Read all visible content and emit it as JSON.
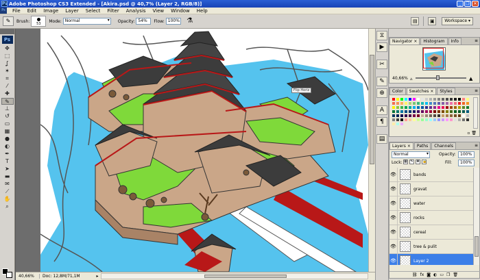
{
  "window": {
    "title": "Adobe Photoshop CS3 Extended - [Akira.psd @ 40,7% (Layer 2, RGB/8)]",
    "logo": "Ps",
    "buttons": {
      "minimize": "_",
      "restore": "❐",
      "close": "✕"
    }
  },
  "menu": [
    "File",
    "Edit",
    "Image",
    "Layer",
    "Select",
    "Filter",
    "Analysis",
    "View",
    "Window",
    "Help"
  ],
  "options": {
    "brush_label": "Brush:",
    "brush_size": "53",
    "mode_label": "Mode:",
    "mode_value": "Normal",
    "opacity_label": "Opacity:",
    "opacity_value": "54%",
    "flow_label": "Flow:",
    "flow_value": "100%",
    "workspace_label": "Workspace"
  },
  "toolbox": {
    "logo": "Ps",
    "tools": [
      {
        "name": "move-tool-icon",
        "glyph": "✥"
      },
      {
        "name": "marquee-tool-icon",
        "glyph": "⬚"
      },
      {
        "name": "lasso-tool-icon",
        "glyph": "ʆ"
      },
      {
        "name": "magic-wand-tool-icon",
        "glyph": "✶"
      },
      {
        "name": "crop-tool-icon",
        "glyph": "⌗"
      },
      {
        "name": "slice-tool-icon",
        "glyph": "⁄"
      },
      {
        "name": "healing-brush-tool-icon",
        "glyph": "✚"
      },
      {
        "name": "brush-tool-icon",
        "glyph": "✎",
        "selected": true
      },
      {
        "name": "clone-stamp-tool-icon",
        "glyph": "⊥"
      },
      {
        "name": "history-brush-tool-icon",
        "glyph": "↺"
      },
      {
        "name": "eraser-tool-icon",
        "glyph": "▭"
      },
      {
        "name": "gradient-tool-icon",
        "glyph": "▦"
      },
      {
        "name": "blur-tool-icon",
        "glyph": "●"
      },
      {
        "name": "dodge-tool-icon",
        "glyph": "◐"
      },
      {
        "name": "pen-tool-icon",
        "glyph": "✒"
      },
      {
        "name": "type-tool-icon",
        "glyph": "T"
      },
      {
        "name": "path-selection-tool-icon",
        "glyph": "➤"
      },
      {
        "name": "shape-tool-icon",
        "glyph": "▬"
      },
      {
        "name": "notes-tool-icon",
        "glyph": "✉"
      },
      {
        "name": "eyedropper-tool-icon",
        "glyph": "⟋"
      },
      {
        "name": "hand-tool-icon",
        "glyph": "✋"
      },
      {
        "name": "zoom-tool-icon",
        "glyph": "⌕"
      }
    ],
    "foreground_color": "#000000",
    "background_color": "#ffffff"
  },
  "document": {
    "zoom": "40,66%",
    "doc_info": "Doc: 12,8M/71,1M",
    "tooltip": "Flip Horiz"
  },
  "navigator": {
    "tabs": [
      "Navigator",
      "Histogram",
      "Info"
    ],
    "zoom": "40,66%"
  },
  "swatches": {
    "tabs": [
      "Color",
      "Swatches",
      "Styles"
    ],
    "colors": [
      "#ff0000",
      "#ffff00",
      "#00ff00",
      "#00ffff",
      "#0000ff",
      "#ff00ff",
      "#ffffff",
      "#e6e6e6",
      "#cccccc",
      "#b3b3b3",
      "#999999",
      "#808080",
      "#666666",
      "#4d4d4d",
      "#333333",
      "#1a1a1a",
      "#000000",
      "#ff8080",
      "#ffff80",
      "#f26c4f",
      "#f68e55",
      "#fbaf5c",
      "#fff467",
      "#acd372",
      "#7cc576",
      "#3bb878",
      "#1abbb4",
      "#00bff3",
      "#438ccb",
      "#5574b9",
      "#605ca8",
      "#855fa8",
      "#a763a8",
      "#f06ea9",
      "#f26d7d",
      "#ed1c24",
      "#f26522",
      "#f7941d",
      "#fff200",
      "#8dc63f",
      "#39b54a",
      "#00a651",
      "#00a99d",
      "#00aeef",
      "#0072bc",
      "#0054a6",
      "#2e3192",
      "#662d91",
      "#92278f",
      "#ec008c",
      "#ed145b",
      "#9e0b0f",
      "#a0410d",
      "#a3620a",
      "#aba000",
      "#598527",
      "#1a7b30",
      "#007236",
      "#00746b",
      "#0076a3",
      "#004b80",
      "#003471",
      "#1b1464",
      "#440e62",
      "#630460",
      "#9e005d",
      "#9e0039",
      "#790000",
      "#7b2e00",
      "#7d4900",
      "#827b00",
      "#406618",
      "#005e20",
      "#005826",
      "#005952",
      "#005b7f",
      "#003663",
      "#002157",
      "#0d004c",
      "#32004b",
      "#4b0049",
      "#7b0046",
      "#7a0026",
      "#c7b299",
      "#998675",
      "#736357",
      "#534741",
      "#37302d",
      "#c69c6d",
      "#a67c52",
      "#8c6239",
      "#754c24",
      "#603913",
      "#ffffff",
      "#c0c0c0",
      "#808080",
      "#404040",
      "#000000",
      "#ff9999",
      "#ffcc99",
      "#ffff99",
      "#ccff99",
      "#99ff99",
      "#99ffcc",
      "#99ffff",
      "#99ccff",
      "#9999ff",
      "#cc99ff",
      "#ff99ff",
      "#ff99cc",
      "#e0e0e0",
      "#b0b0b0",
      "#707070",
      "#303030",
      "#ffeeaa",
      "#aaffee",
      "#eeaaff"
    ]
  },
  "layers": {
    "tabs": [
      "Layers",
      "Paths",
      "Channels"
    ],
    "blend_mode": "Normal",
    "opacity_label": "Opacity:",
    "opacity_value": "100%",
    "lock_label": "Lock:",
    "fill_label": "Fill:",
    "fill_value": "100%",
    "items": [
      {
        "name": "bands",
        "selected": false
      },
      {
        "name": "gravat",
        "selected": false
      },
      {
        "name": "water",
        "selected": false
      },
      {
        "name": "rocks",
        "selected": false
      },
      {
        "name": "cereal",
        "selected": false
      },
      {
        "name": "tree & pulit",
        "selected": false
      },
      {
        "name": "Layer 2",
        "selected": true
      }
    ],
    "footer_icons": [
      "link-icon",
      "fx-icon",
      "mask-icon",
      "adjustment-icon",
      "folder-icon",
      "new-layer-icon",
      "trash-icon"
    ]
  },
  "colors": {
    "title_bar": "#1f4fc4",
    "water": "#55c3ee",
    "grass": "#7fd93a",
    "wall": "#caa688",
    "roof": "#3c3c3c",
    "trim": "#b81818"
  }
}
